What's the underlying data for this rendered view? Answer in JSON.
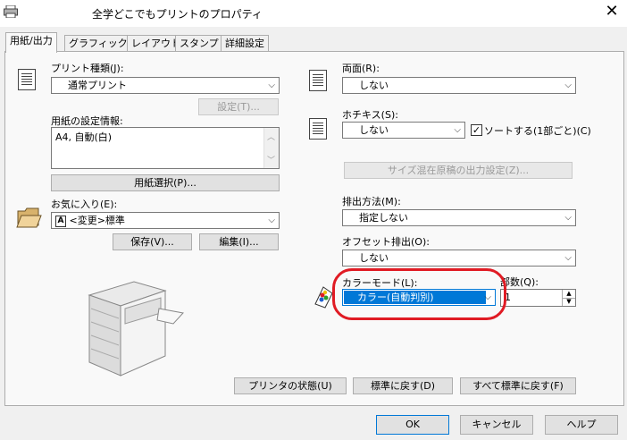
{
  "window": {
    "title": "全学どこでもプリントのプロパティ",
    "close_glyph": "✕"
  },
  "tabs": [
    "用紙/出力",
    "グラフィックス",
    "レイアウト",
    "スタンプ",
    "詳細設定"
  ],
  "left": {
    "print_type_label": "プリント種類(J):",
    "print_type_value": "通常プリント",
    "settings_button": "設定(T)...",
    "paper_info_label": "用紙の設定情報:",
    "paper_info_value": "A4, 自動(白)",
    "select_paper_button": "用紙選択(P)...",
    "favorites_label": "お気に入り(E):",
    "favorites_value": "<変更>標準",
    "favorites_badge": "A",
    "save_button": "保存(V)...",
    "edit_button": "編集(I)..."
  },
  "right": {
    "duplex_label": "両面(R):",
    "duplex_value": "しない",
    "staple_label": "ホチキス(S):",
    "staple_value": "しない",
    "sort_label": "ソートする(1部ごと)(C)",
    "sort_checked": "✓",
    "mixed_size_button": "サイズ混在原稿の出力設定(Z)...",
    "output_method_label": "排出方法(M):",
    "output_method_value": "指定しない",
    "offset_label": "オフセット排出(O):",
    "offset_value": "しない",
    "color_mode_label": "カラーモード(L):",
    "color_mode_value": "カラー(自動判別)",
    "copies_label": "部数(Q):",
    "copies_value": "1"
  },
  "bottom_buttons": {
    "printer_status": "プリンタの状態(U)",
    "reset": "標準に戻す(D)",
    "reset_all": "すべて標準に戻す(F)"
  },
  "dialog_buttons": {
    "ok": "OK",
    "cancel": "キャンセル",
    "help": "ヘルプ"
  },
  "colors": {
    "accent": "#0078d7",
    "highlight_ring": "#e01b24"
  }
}
